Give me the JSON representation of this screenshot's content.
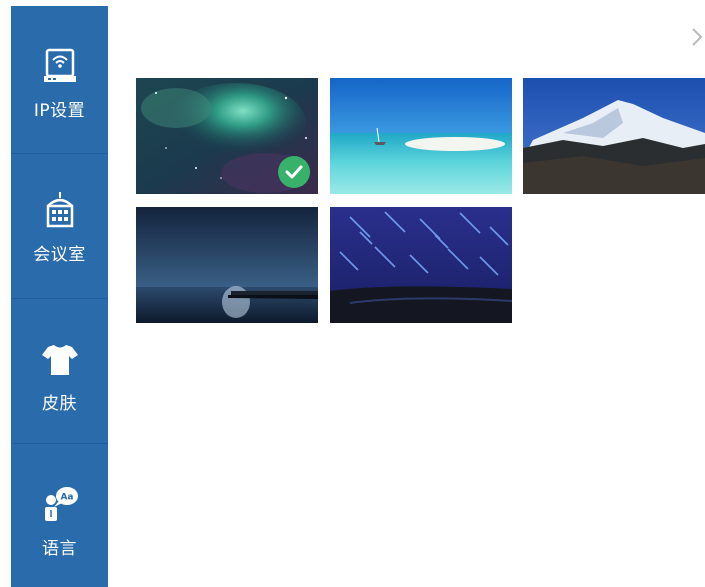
{
  "sidebar": {
    "items": [
      {
        "label": "IP设置",
        "icon": "router-icon"
      },
      {
        "label": "会议室",
        "icon": "building-icon"
      },
      {
        "label": "皮肤",
        "icon": "tshirt-icon"
      },
      {
        "label": "语言",
        "icon": "language-icon"
      }
    ]
  },
  "gallery": {
    "selected_index": 0,
    "items": [
      {
        "name": "nebula"
      },
      {
        "name": "beach"
      },
      {
        "name": "mountain"
      },
      {
        "name": "night-sea"
      },
      {
        "name": "star-trails"
      }
    ]
  },
  "colors": {
    "sidebar_bg": "#2a6cab",
    "check_green": "#38b26a"
  }
}
